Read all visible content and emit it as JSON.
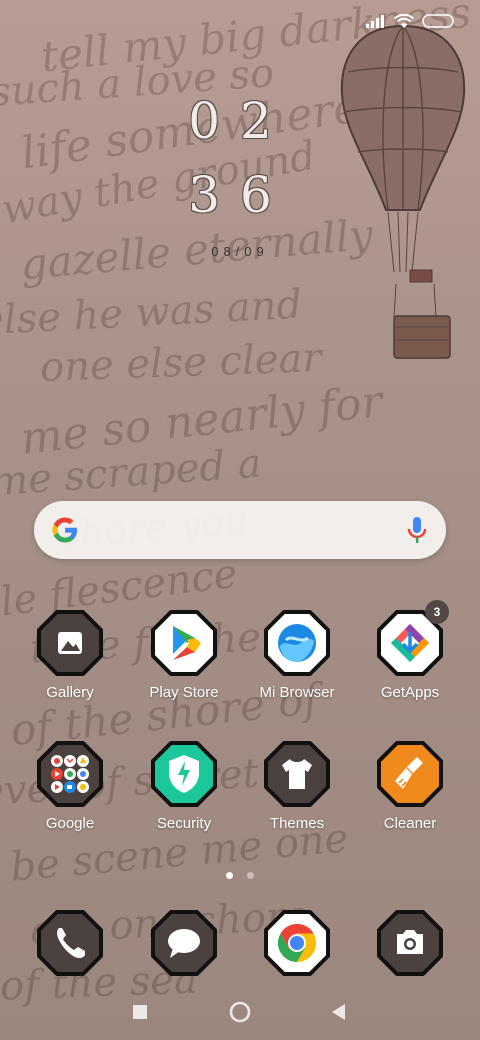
{
  "clock": {
    "hour": "02",
    "minute": "36",
    "date": "08/09"
  },
  "search": {
    "logo": "google-g-icon",
    "mic": "microphone-icon"
  },
  "apps": [
    {
      "label": "Gallery",
      "icon": "gallery-icon"
    },
    {
      "label": "Play Store",
      "icon": "play-store-icon"
    },
    {
      "label": "Mi Browser",
      "icon": "mi-browser-icon"
    },
    {
      "label": "GetApps",
      "icon": "getapps-icon",
      "badge": "3"
    },
    {
      "label": "Google",
      "icon": "google-folder-icon"
    },
    {
      "label": "Security",
      "icon": "security-shield-icon"
    },
    {
      "label": "Themes",
      "icon": "themes-shirt-icon"
    },
    {
      "label": "Cleaner",
      "icon": "cleaner-broom-icon"
    }
  ],
  "dock": [
    {
      "name": "phone",
      "icon": "phone-icon"
    },
    {
      "name": "messages",
      "icon": "message-icon"
    },
    {
      "name": "chrome",
      "icon": "chrome-icon"
    },
    {
      "name": "camera",
      "icon": "camera-icon"
    }
  ],
  "page_indicator": {
    "pages": 2,
    "current": 1
  },
  "colors": {
    "icon_dark": "#4b4240",
    "icon_ring": "#111111",
    "badge": "#514744"
  }
}
